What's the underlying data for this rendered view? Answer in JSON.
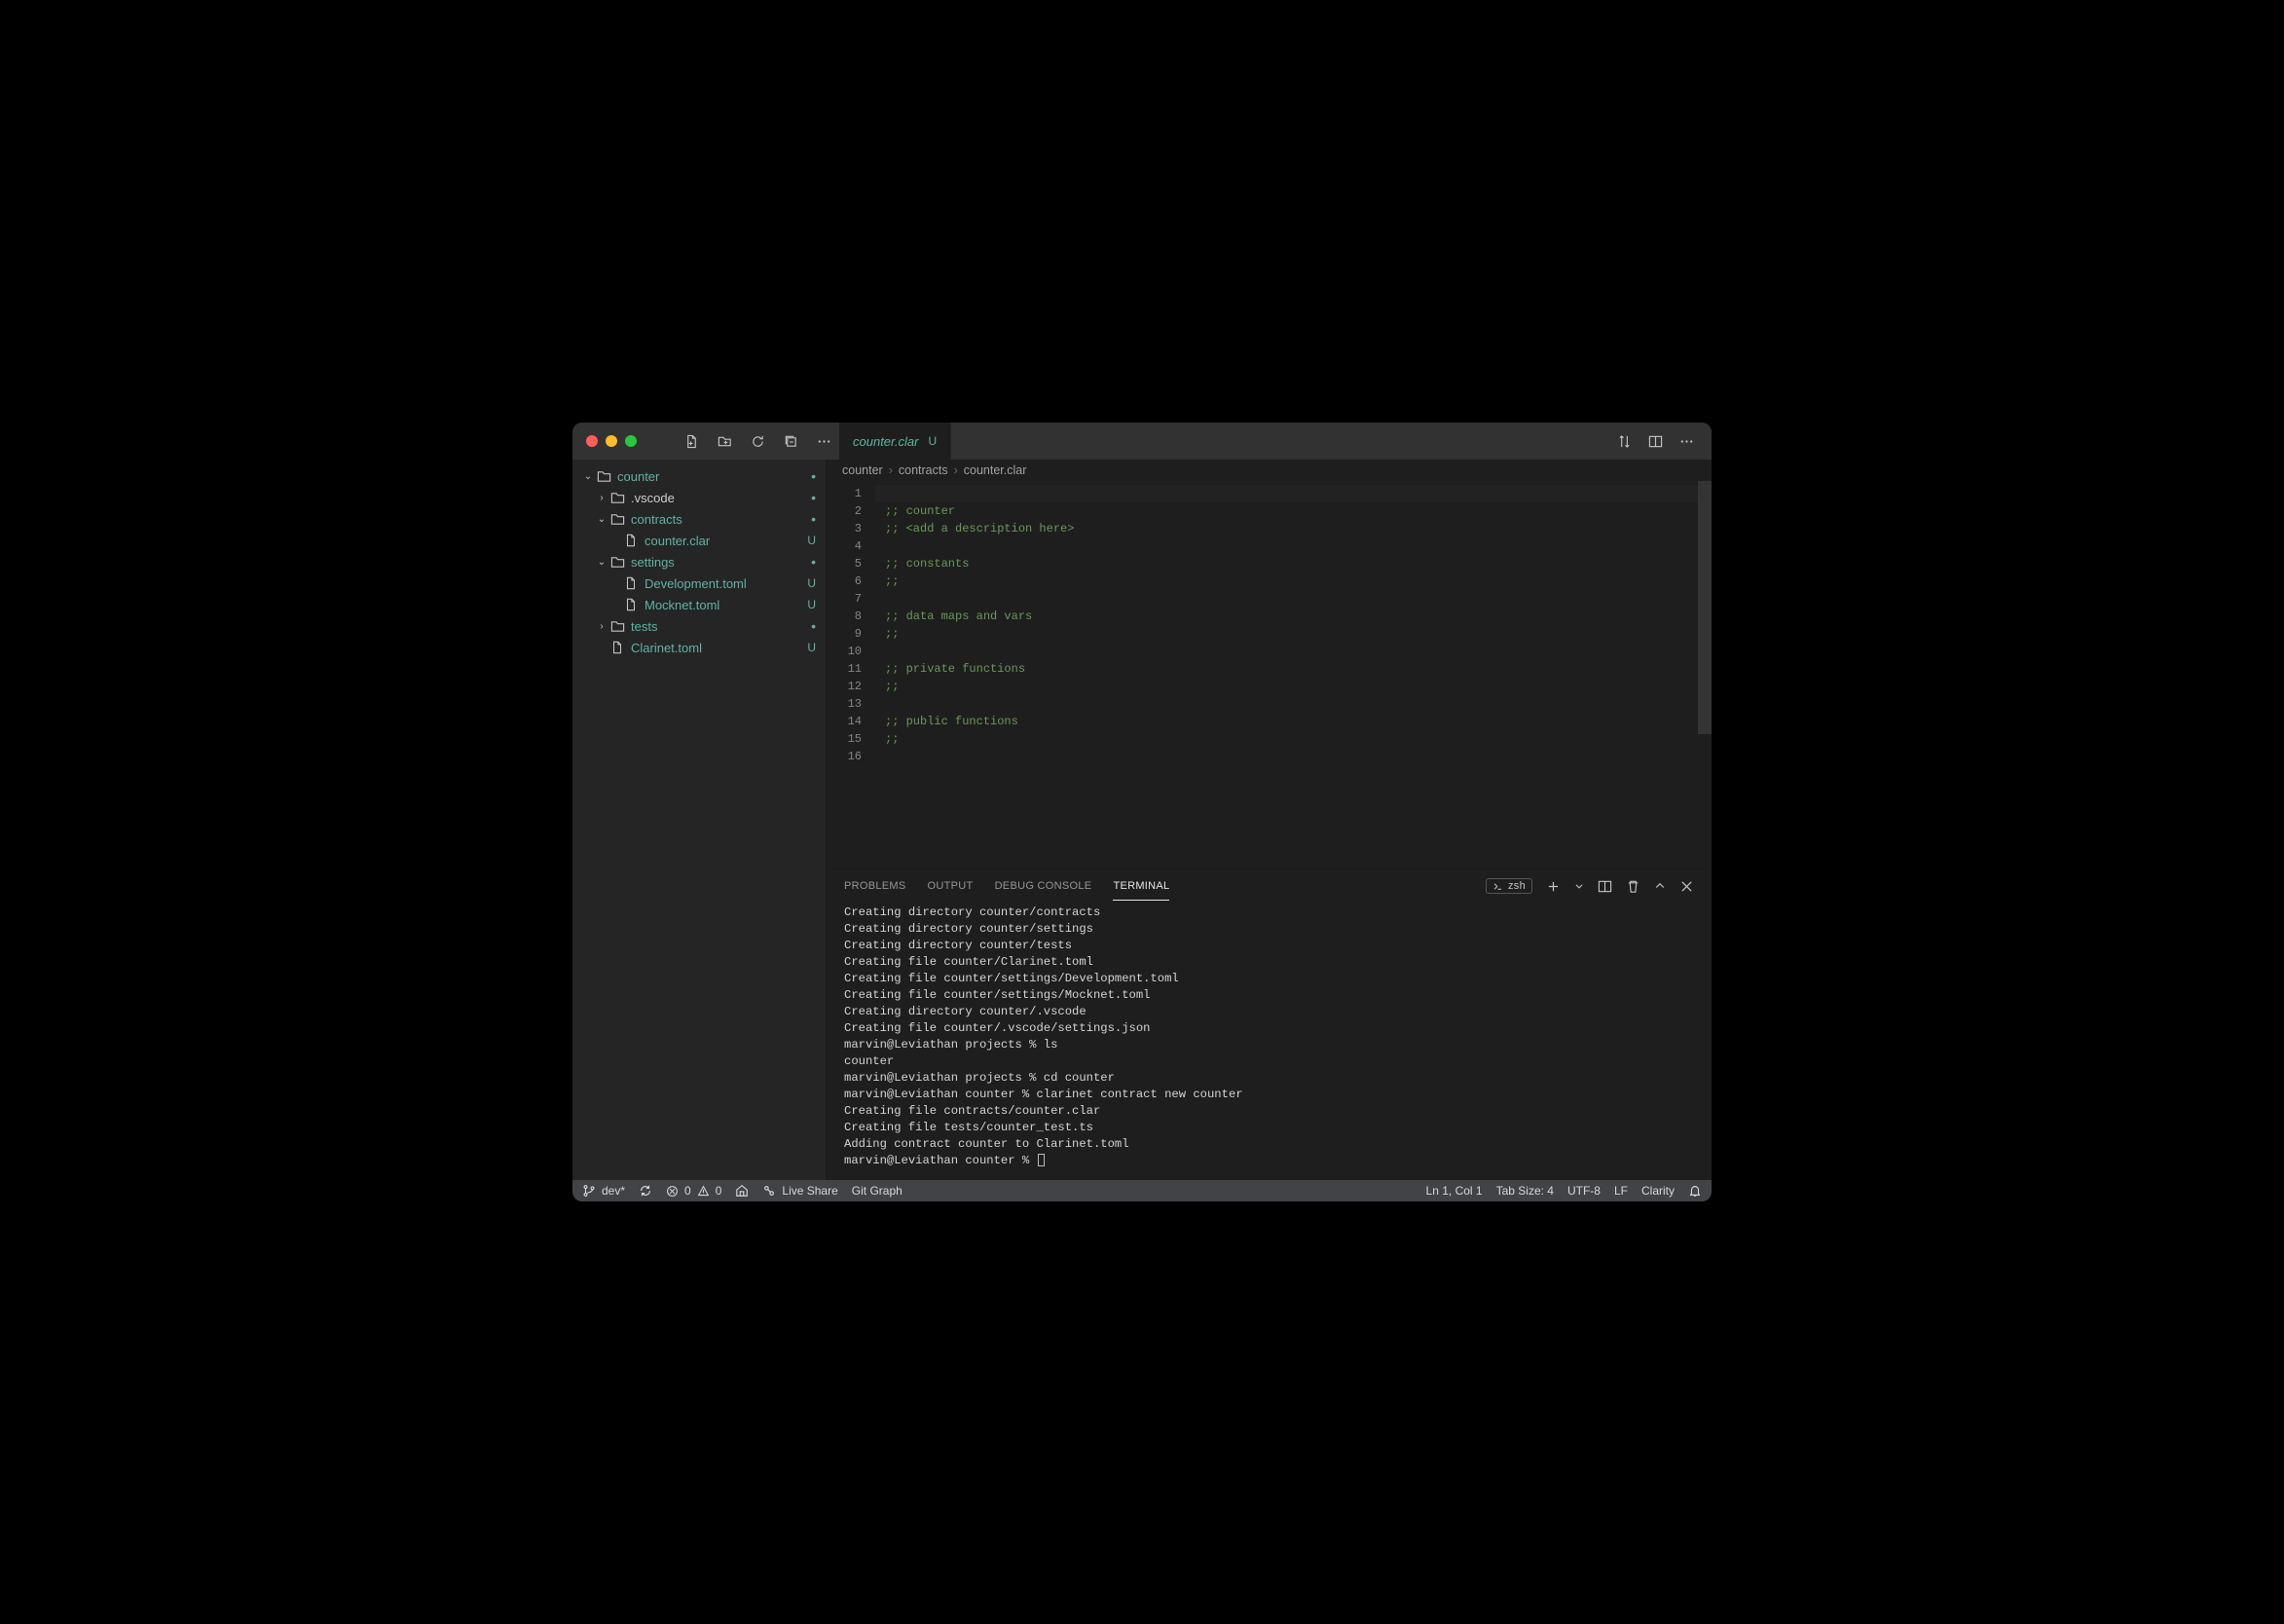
{
  "tab": {
    "filename": "counter.clar",
    "status": "U"
  },
  "breadcrumbs": [
    "counter",
    "contracts",
    "counter.clar"
  ],
  "explorer": {
    "rows": [
      {
        "indent": 0,
        "expand": "down",
        "kind": "folder",
        "label": "counter",
        "status": "dot",
        "git": true
      },
      {
        "indent": 1,
        "expand": "right",
        "kind": "folder",
        "label": ".vscode",
        "status": "dot",
        "git": false
      },
      {
        "indent": 1,
        "expand": "down",
        "kind": "folder",
        "label": "contracts",
        "status": "dot",
        "git": true
      },
      {
        "indent": 2,
        "expand": "",
        "kind": "file",
        "label": "counter.clar",
        "status": "U",
        "git": true
      },
      {
        "indent": 1,
        "expand": "down",
        "kind": "folder",
        "label": "settings",
        "status": "dot",
        "git": true
      },
      {
        "indent": 2,
        "expand": "",
        "kind": "file",
        "label": "Development.toml",
        "status": "U",
        "git": true
      },
      {
        "indent": 2,
        "expand": "",
        "kind": "file",
        "label": "Mocknet.toml",
        "status": "U",
        "git": true
      },
      {
        "indent": 1,
        "expand": "right",
        "kind": "folder",
        "label": "tests",
        "status": "dot",
        "git": true
      },
      {
        "indent": 1,
        "expand": "",
        "kind": "file",
        "label": "Clarinet.toml",
        "status": "U",
        "git": true
      }
    ]
  },
  "editor": {
    "lines": [
      "",
      ";; counter",
      ";; <add a description here>",
      "",
      ";; constants",
      ";;",
      "",
      ";; data maps and vars",
      ";;",
      "",
      ";; private functions",
      ";;",
      "",
      ";; public functions",
      ";;",
      ""
    ]
  },
  "panel": {
    "tabs": [
      "PROBLEMS",
      "OUTPUT",
      "DEBUG CONSOLE",
      "TERMINAL"
    ],
    "active": 3,
    "shell": "zsh",
    "terminal_lines": [
      "Creating directory counter/contracts",
      "Creating directory counter/settings",
      "Creating directory counter/tests",
      "Creating file counter/Clarinet.toml",
      "Creating file counter/settings/Development.toml",
      "Creating file counter/settings/Mocknet.toml",
      "Creating directory counter/.vscode",
      "Creating file counter/.vscode/settings.json",
      "marvin@Leviathan projects % ls",
      "counter",
      "marvin@Leviathan projects % cd counter",
      "marvin@Leviathan counter % clarinet contract new counter",
      "",
      "Creating file contracts/counter.clar",
      "Creating file tests/counter_test.ts",
      "Adding contract counter to Clarinet.toml",
      "marvin@Leviathan counter % "
    ]
  },
  "status": {
    "branch": "dev*",
    "errors": "0",
    "warnings": "0",
    "live_share": "Live Share",
    "git_graph": "Git Graph",
    "position": "Ln 1, Col 1",
    "tab_size": "Tab Size: 4",
    "encoding": "UTF-8",
    "eol": "LF",
    "language": "Clarity"
  }
}
